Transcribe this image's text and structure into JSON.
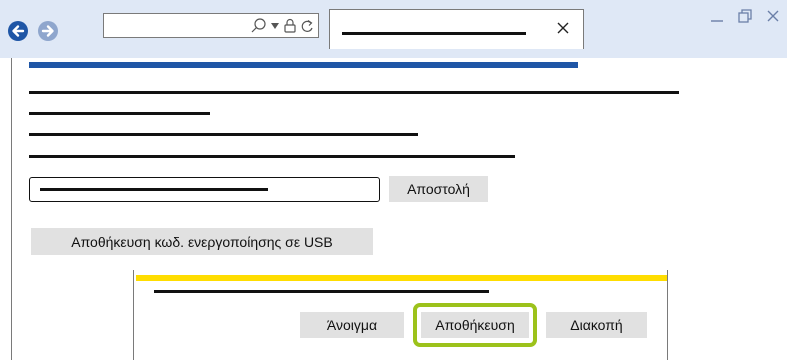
{
  "colors": {
    "chrome_background": "#dfe8f6",
    "accent_blue": "#1f56a6",
    "dialog_accent": "#ffdd00",
    "highlight": "#9cc21b",
    "button_bg": "#e1e1e1"
  },
  "browser": {
    "nav": {
      "back_icon": "arrow-left-icon",
      "forward_icon": "arrow-right-icon"
    },
    "address_bar": {
      "icons": [
        "search-icon",
        "dropdown-icon",
        "lock-icon",
        "refresh-icon"
      ]
    },
    "tab": {
      "close_icon": "close-icon"
    },
    "window_controls": [
      "minimize-icon",
      "maximize-icon",
      "close-icon"
    ]
  },
  "page": {
    "send_button": "Αποστολή",
    "save_usb_button": "Αποθήκευση κωδ. ενεργοποίησης σε USB"
  },
  "dialog": {
    "open_button": "Άνοιγμα",
    "save_button": "Αποθήκευση",
    "cancel_button": "Διακοπή"
  }
}
